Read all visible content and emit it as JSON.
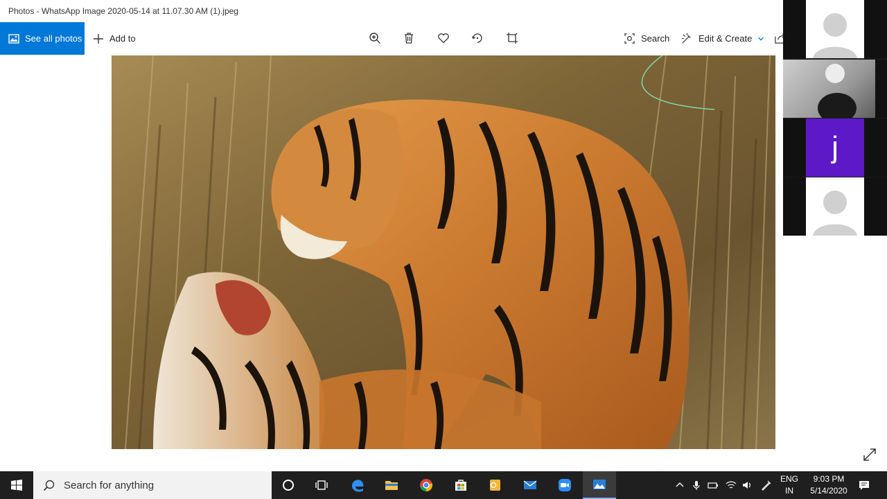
{
  "window": {
    "title": "Photos - WhatsApp Image 2020-05-14 at 11.07.30 AM (1).jpeg"
  },
  "toolbar": {
    "see_all_label": "See all photos",
    "add_to_label": "Add to",
    "search_label": "Search",
    "edit_create_label": "Edit & Create",
    "icons": [
      "zoom-icon",
      "delete-icon",
      "favorite-icon",
      "rotate-icon",
      "crop-icon",
      "share-icon"
    ]
  },
  "video_panel": {
    "tiles": [
      {
        "type": "avatar"
      },
      {
        "type": "camera"
      },
      {
        "type": "initial",
        "initial": "j"
      },
      {
        "type": "avatar"
      }
    ],
    "initial_color": "#5d19c7"
  },
  "taskbar": {
    "search_placeholder": "Search for anything",
    "apps": [
      "cortana-icon",
      "task-view-icon",
      "edge-icon",
      "file-explorer-icon",
      "chrome-icon",
      "store-icon",
      "outlook-icon",
      "mail-icon",
      "zoom-icon",
      "photos-icon"
    ],
    "language": {
      "line1": "ENG",
      "line2": "IN"
    },
    "clock": {
      "time": "9:03 PM",
      "date": "5/14/2020"
    }
  },
  "colors": {
    "accent": "#0078d7",
    "taskbar": "#1f1f1f"
  }
}
